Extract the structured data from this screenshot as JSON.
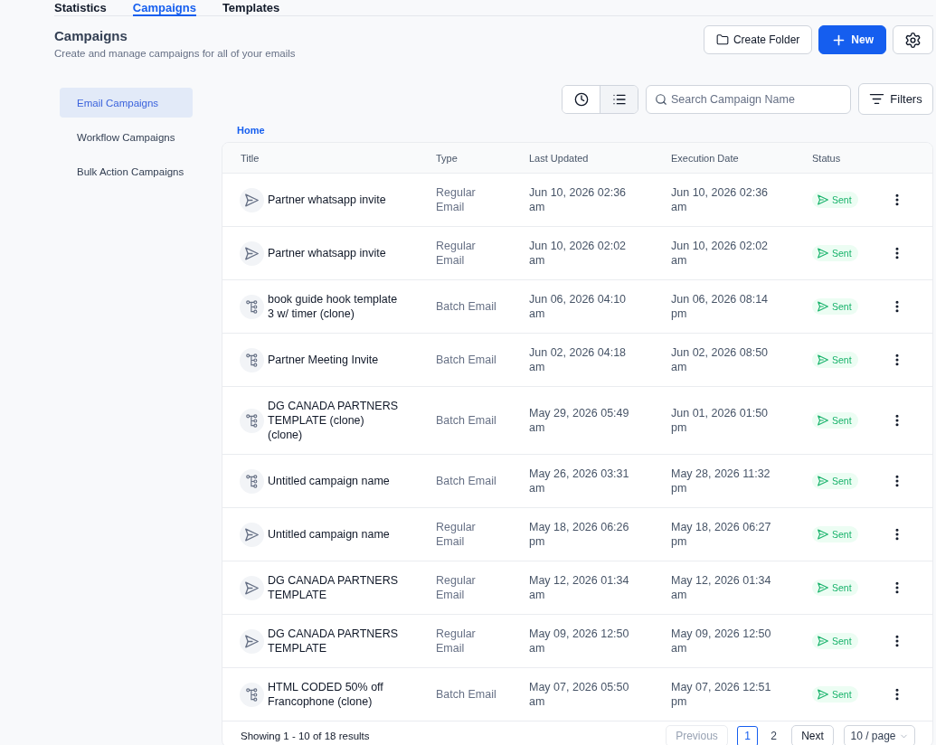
{
  "top_tabs": [
    {
      "label": "Statistics",
      "selected": false
    },
    {
      "label": "Campaigns",
      "selected": true
    },
    {
      "label": "Templates",
      "selected": false
    }
  ],
  "header": {
    "title": "Campaigns",
    "subtitle": "Create and manage campaigns for all of your emails",
    "buttons": [
      {
        "kind": "folder",
        "label": "Create Folder"
      },
      {
        "kind": "new",
        "label": "New"
      },
      {
        "kind": "settings"
      }
    ]
  },
  "sidebar": {
    "items": [
      {
        "label": "Email Campaigns",
        "selected": true
      },
      {
        "label": "Workflow Campaigns",
        "selected": false
      },
      {
        "label": "Bulk Action Campaigns",
        "selected": false
      }
    ]
  },
  "toolbar": {
    "view_toggle": [
      {
        "kind": "clock",
        "selected": false
      },
      {
        "kind": "list",
        "selected": true
      }
    ],
    "search": {
      "placeholder": "Search Campaign Name"
    },
    "filters_button": "Filters"
  },
  "breadcrumb": "Home",
  "table": {
    "columns": [
      "Title",
      "Type",
      "Last Updated",
      "Execution Date",
      "Status"
    ],
    "rows": [
      {
        "kind": "regular",
        "title": "Partner whatsapp invite",
        "type": "Regular Email",
        "last_updated": "Jun 10, 2026 02:36 am",
        "execution_date": "Jun 10, 2026 02:36 am",
        "status": "Sent"
      },
      {
        "kind": "regular",
        "title": "Partner whatsapp invite",
        "type": "Regular Email",
        "last_updated": "Jun 10, 2026 02:02 am",
        "execution_date": "Jun 10, 2026 02:02 am",
        "status": "Sent"
      },
      {
        "kind": "batch",
        "title": "book guide hook template 3 w/ timer (clone)",
        "type": "Batch Email",
        "last_updated": "Jun 06, 2026 04:10 am",
        "execution_date": "Jun 06, 2026 08:14 pm",
        "status": "Sent"
      },
      {
        "kind": "batch",
        "title": "Partner Meeting Invite",
        "type": "Batch Email",
        "last_updated": "Jun 02, 2026 04:18 am",
        "execution_date": "Jun 02, 2026 08:50 am",
        "status": "Sent"
      },
      {
        "kind": "batch",
        "title": "DG CANADA PARTNERS TEMPLATE (clone) (clone)",
        "type": "Batch Email",
        "last_updated": "May 29, 2026 05:49 am",
        "execution_date": "Jun 01, 2026 01:50 pm",
        "status": "Sent"
      },
      {
        "kind": "batch",
        "title": "Untitled campaign name",
        "type": "Batch Email",
        "last_updated": "May 26, 2026 03:31 am",
        "execution_date": "May 28, 2026 11:32 pm",
        "status": "Sent"
      },
      {
        "kind": "regular",
        "title": "Untitled campaign name",
        "type": "Regular Email",
        "last_updated": "May 18, 2026 06:26 pm",
        "execution_date": "May 18, 2026 06:27 pm",
        "status": "Sent"
      },
      {
        "kind": "regular",
        "title": "DG CANADA PARTNERS TEMPLATE",
        "type": "Regular Email",
        "last_updated": "May 12, 2026 01:34 am",
        "execution_date": "May 12, 2026 01:34 am",
        "status": "Sent"
      },
      {
        "kind": "regular",
        "title": "DG CANADA PARTNERS TEMPLATE",
        "type": "Regular Email",
        "last_updated": "May 09, 2026 12:50 am",
        "execution_date": "May 09, 2026 12:50 am",
        "status": "Sent"
      },
      {
        "kind": "batch",
        "title": "HTML CODED 50% off Francophone (clone)",
        "type": "Batch Email",
        "last_updated": "May 07, 2026 05:50 am",
        "execution_date": "May 07, 2026 12:51 pm",
        "status": "Sent"
      }
    ]
  },
  "footer": {
    "summary": "Showing 1 - 10 of 18 results",
    "pagination": {
      "previous": {
        "label": "Previous",
        "disabled": true
      },
      "pages": [
        {
          "label": "1",
          "selected": true
        },
        {
          "label": "2",
          "selected": false
        }
      ],
      "next": {
        "label": "Next",
        "disabled": false
      },
      "page_size": "10 / page"
    }
  }
}
